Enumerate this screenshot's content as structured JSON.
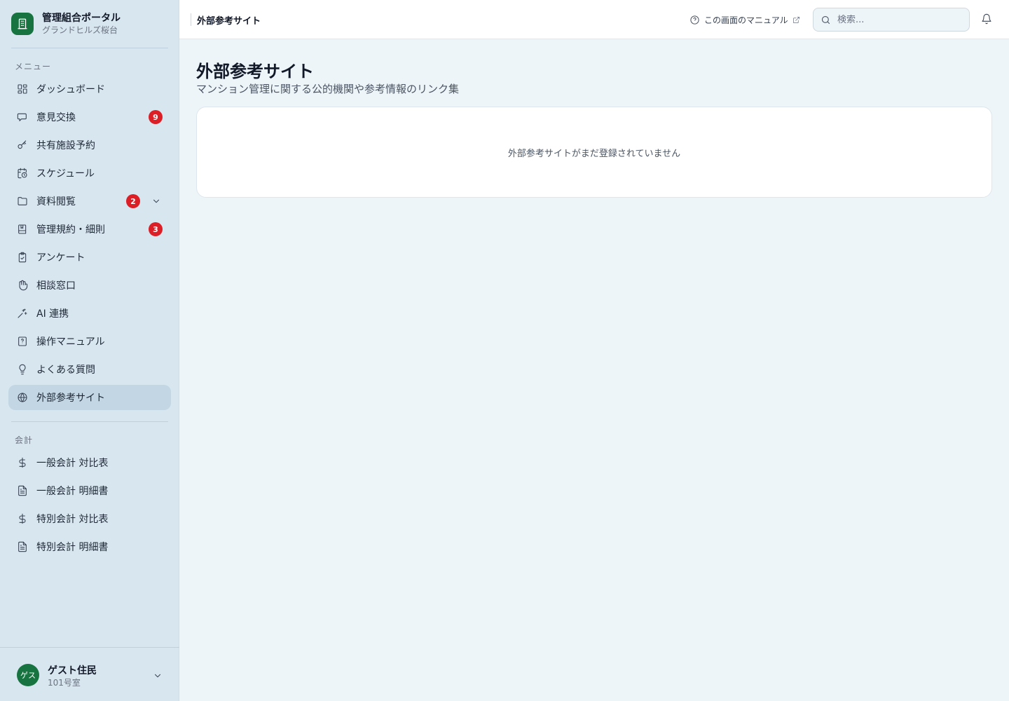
{
  "brand": {
    "title": "管理組合ポータル",
    "subtitle": "グランドヒルズ桜台",
    "logo_icon": "building-icon",
    "color": "#17733f"
  },
  "sidebar": {
    "menu_label": "メニュー",
    "items": [
      {
        "label": "ダッシュボード",
        "icon": "dashboard-grid-icon"
      },
      {
        "label": "意見交換",
        "icon": "chat-bubble-icon",
        "badge": "9"
      },
      {
        "label": "共有施設予約",
        "icon": "key-icon"
      },
      {
        "label": "スケジュール",
        "icon": "calendar-clock-icon"
      },
      {
        "label": "資料閲覧",
        "icon": "folder-icon",
        "badge": "2",
        "expandable": true
      },
      {
        "label": "管理規約・細則",
        "icon": "book-icon",
        "badge": "3"
      },
      {
        "label": "アンケート",
        "icon": "clipboard-check-icon"
      },
      {
        "label": "相談窓口",
        "icon": "hand-icon"
      },
      {
        "label": "AI 連携",
        "icon": "sparkles-icon"
      },
      {
        "label": "操作マニュアル",
        "icon": "manual-book-icon"
      },
      {
        "label": "よくある質問",
        "icon": "lightbulb-icon"
      },
      {
        "label": "外部参考サイト",
        "icon": "globe-icon",
        "active": true
      }
    ],
    "accounting_label": "会計",
    "accounting_items": [
      {
        "label": "一般会計 対比表",
        "icon": "dollar-icon"
      },
      {
        "label": "一般会計 明細書",
        "icon": "document-icon"
      },
      {
        "label": "特別会計 対比表",
        "icon": "dollar-icon"
      },
      {
        "label": "特別会計 明細書",
        "icon": "document-icon"
      }
    ]
  },
  "user": {
    "avatar_text": "ゲス",
    "name": "ゲスト住民",
    "room": "101号室"
  },
  "header": {
    "title": "外部参考サイト",
    "manual_link": "この画面のマニュアル",
    "search_placeholder": "検索..."
  },
  "main": {
    "title": "外部参考サイト",
    "subtitle": "マンション管理に関する公的機関や参考情報のリンク集",
    "empty_message": "外部参考サイトがまだ登録されていません"
  },
  "colors": {
    "accent": "#17733f",
    "badge": "#dc1f26",
    "sidebar_bg": "#d8e6f0",
    "active_bg": "#c3d6e3",
    "page_bg": "#eef5f9"
  }
}
